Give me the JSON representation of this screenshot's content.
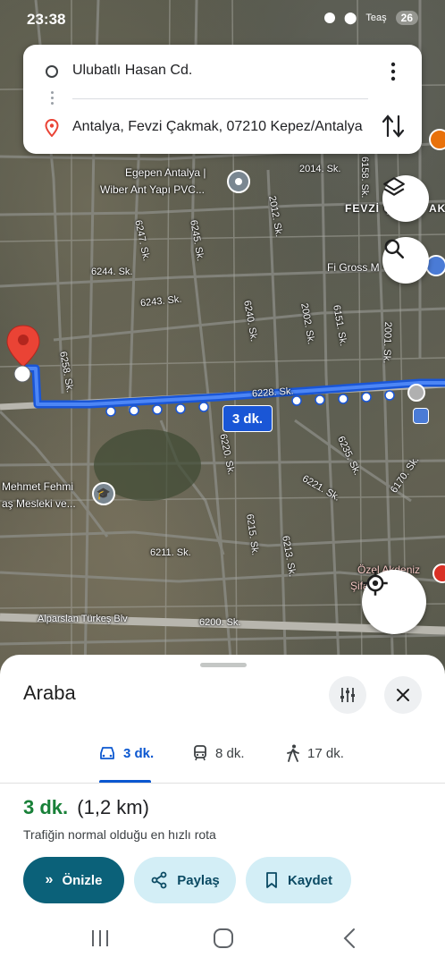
{
  "status_bar": {
    "time": "23:38",
    "carrier": "Teaş",
    "badge_text": "26"
  },
  "route_card": {
    "origin": "Ulubatlı Hasan Cd.",
    "destination": "Antalya, Fevzi Çakmak, 07210 Kepez/Antalya",
    "more_icon": "more-vert-icon",
    "swap_icon": "swap-vert-icon"
  },
  "map": {
    "route_time_badge": "3 dk.",
    "labels": {
      "poi_egepen": "Egepen Antalya |",
      "poi_egepen2": "Wiber Ant Yapı PVC...",
      "poi_figross": "Fi Gross M",
      "district_fevzi": "FEVZİ Ç",
      "district_fevzi2": "AK",
      "school_1": "Mehmet Fehmi",
      "school_2": "aş Mesleki ve...",
      "hospital_1": "Özel Akdeniz",
      "hospital_2": "Şifa",
      "street_2014": "2014. Sk.",
      "street_6244": "6244. Sk.",
      "street_6243": "6243. Sk.",
      "street_6228": "6228. Sk.",
      "street_6211": "6211. Sk.",
      "street_6200": "6200. Sk.",
      "street_alparslan": "Alparslan Türkeş Blv",
      "street_2012": "2012. Sk.",
      "street_6247": "6247. Sk.",
      "street_6245": "6245. Sk.",
      "street_6240": "6240. Sk.",
      "street_2002": "2002. Sk.",
      "street_6151": "6151. Sk.",
      "street_2001": "2001. Sk.",
      "street_6158": "6158. Sk.",
      "street_6258": "6258. Sk.",
      "street_6220": "6220. Sk.",
      "street_6215": "6215. Sk.",
      "street_6213": "6213. Sk.",
      "street_6235": "6235. Sk.",
      "street_6221": "6221. Sk.",
      "street_6170": "6170. Sk."
    }
  },
  "sheet": {
    "title": "Araba",
    "filter_icon": "tune-icon",
    "close_icon": "close-icon",
    "tabs": [
      {
        "label": "3 dk.",
        "icon": "car-icon",
        "active": true
      },
      {
        "label": "8 dk.",
        "icon": "transit-icon",
        "active": false
      },
      {
        "label": "17 dk.",
        "icon": "walk-icon",
        "active": false
      }
    ],
    "duration": "3 dk.",
    "distance": "(1,2 km)",
    "description": "Trafiğin normal olduğu en hızlı rota",
    "buttons": {
      "preview": "Önizle",
      "share": "Paylaş",
      "save": "Kaydet"
    },
    "colors": {
      "accent_blue": "#0b57d0",
      "duration_green": "#188038",
      "primary_button": "#0b6179",
      "secondary_button": "#d3eef6"
    }
  }
}
